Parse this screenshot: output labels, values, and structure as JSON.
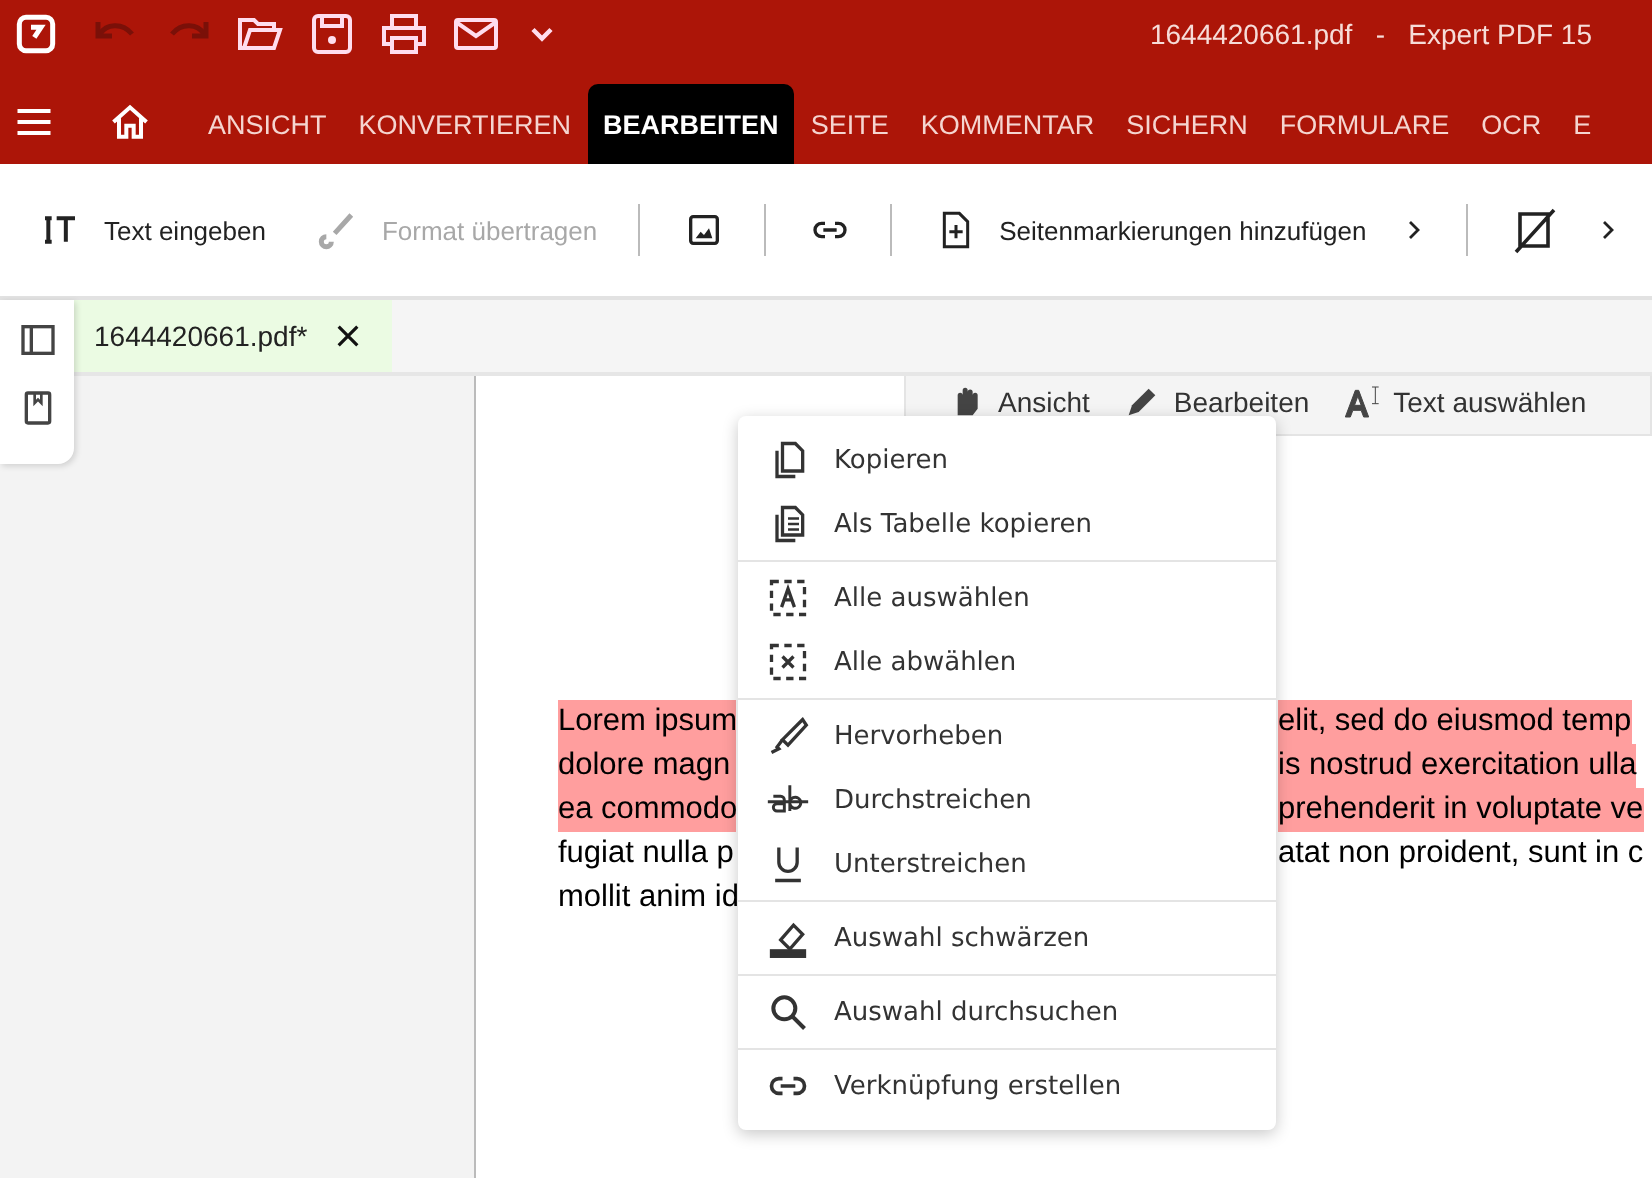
{
  "window": {
    "title": "1644420661.pdf   -   Expert PDF 15"
  },
  "quick_access": [
    {
      "kind": "undo",
      "disabled": true
    },
    {
      "kind": "redo",
      "disabled": true
    },
    {
      "kind": "open",
      "disabled": false
    },
    {
      "kind": "save",
      "disabled": false
    },
    {
      "kind": "print",
      "disabled": false
    },
    {
      "kind": "mail",
      "disabled": false
    },
    {
      "kind": "more",
      "disabled": false
    }
  ],
  "ribbon_tabs": [
    {
      "label": "ANSICHT",
      "selected": false
    },
    {
      "label": "KONVERTIEREN",
      "selected": false
    },
    {
      "label": "BEARBEITEN",
      "selected": true
    },
    {
      "label": "SEITE",
      "selected": false
    },
    {
      "label": "KOMMENTAR",
      "selected": false
    },
    {
      "label": "SICHERN",
      "selected": false
    },
    {
      "label": "FORMULARE",
      "selected": false
    },
    {
      "label": "OCR",
      "selected": false
    },
    {
      "label": "E",
      "selected": false
    }
  ],
  "toolbar": [
    {
      "kind": "text",
      "label": "Text eingeben",
      "disabled": false
    },
    {
      "kind": "brush",
      "label": "Format übertragen",
      "disabled": true
    },
    {
      "kind": "image",
      "disabled": false
    },
    {
      "kind": "link",
      "disabled": false
    },
    {
      "kind": "page-add",
      "label": "Seitenmarkierungen hinzufügen",
      "disabled": false,
      "submenu": true
    },
    {
      "kind": "crop",
      "disabled": false,
      "submenu": true
    }
  ],
  "document_tab": {
    "title": "1644420661.pdf*"
  },
  "page_toolbar": [
    {
      "kind": "hand",
      "label": "Ansicht"
    },
    {
      "kind": "pen",
      "label": "Bearbeiten"
    },
    {
      "kind": "select",
      "label": "Text auswählen"
    }
  ],
  "document_lines": [
    {
      "left": "Lorem ipsum",
      "right": "elit, sed do eiusmod temp",
      "highlighted": true
    },
    {
      "left": "dolore magn",
      "right": "is nostrud exercitation ulla",
      "highlighted": true
    },
    {
      "left": "ea commodo",
      "right": "prehenderit in voluptate ve",
      "highlighted": true
    },
    {
      "left": "fugiat nulla p",
      "right": "atat non proident, sunt in c",
      "highlighted": false
    },
    {
      "left": "mollit anim id",
      "highlighted": false
    }
  ],
  "context_menu": [
    [
      {
        "kind": "copy",
        "label": "Kopieren"
      },
      {
        "kind": "table",
        "label": "Als Tabelle kopieren"
      }
    ],
    [
      {
        "kind": "select-all",
        "label": "Alle auswählen"
      },
      {
        "kind": "deselect",
        "label": "Alle abwählen"
      }
    ],
    [
      {
        "kind": "highlight",
        "label": "Hervorheben"
      },
      {
        "kind": "strike",
        "label": "Durchstreichen"
      },
      {
        "kind": "underline",
        "label": "Unterstreichen"
      }
    ],
    [
      {
        "kind": "redact",
        "label": "Auswahl schwärzen"
      }
    ],
    [
      {
        "kind": "search",
        "label": "Auswahl durchsuchen"
      }
    ],
    [
      {
        "kind": "link",
        "label": "Verknüpfung erstellen"
      }
    ]
  ]
}
